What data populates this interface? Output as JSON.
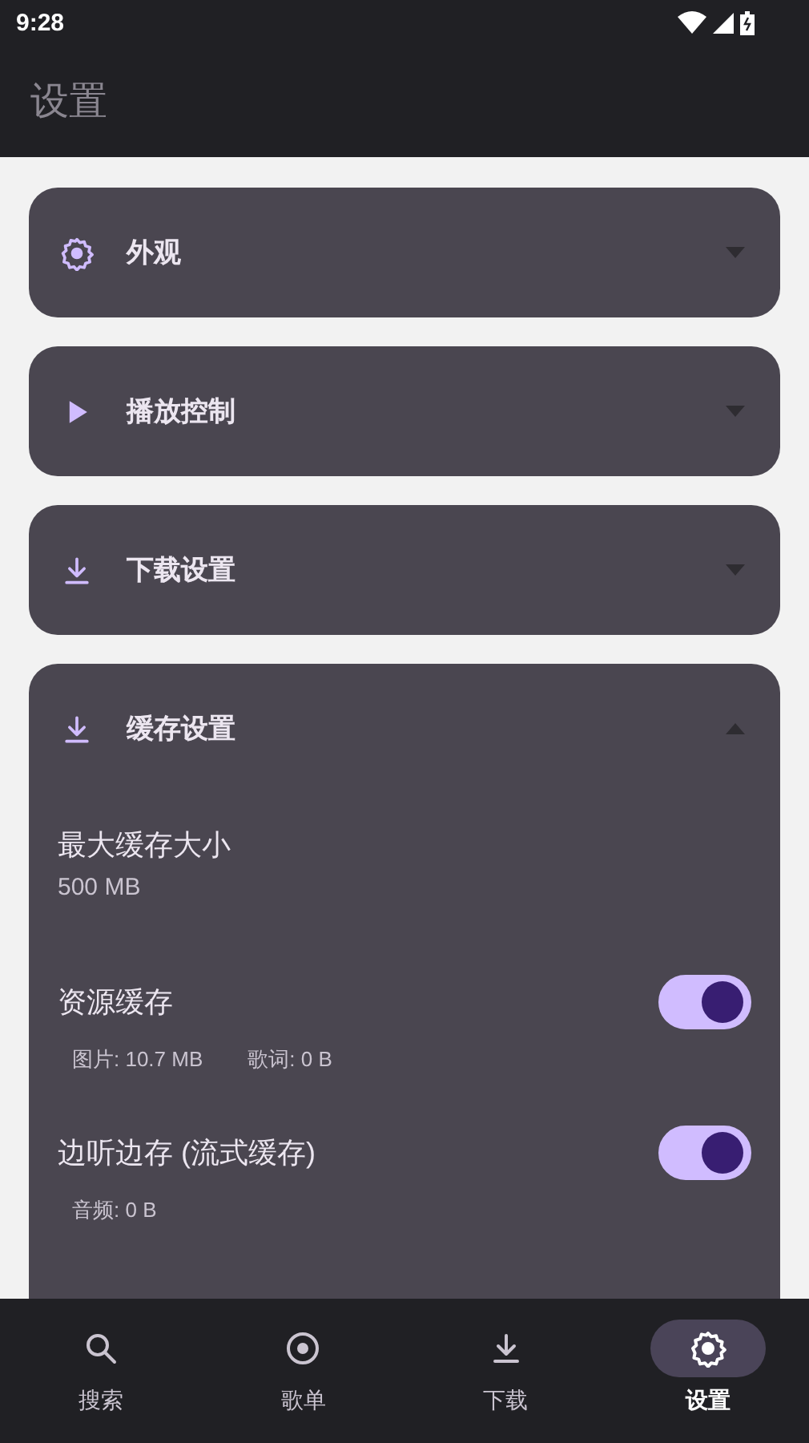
{
  "status_bar": {
    "time": "9:28"
  },
  "app_bar": {
    "title": "设置"
  },
  "sections": [
    {
      "kind": "gear",
      "title": "外观",
      "expanded": false
    },
    {
      "kind": "play",
      "title": "播放控制",
      "expanded": false
    },
    {
      "kind": "download",
      "title": "下载设置",
      "expanded": false
    },
    {
      "kind": "download",
      "title": "缓存设置",
      "expanded": true,
      "items": [
        {
          "kind": "value",
          "title": "最大缓存大小",
          "value": "500 MB"
        },
        {
          "kind": "toggle",
          "title": "资源缓存",
          "on": true,
          "stats": [
            "图片: 10.7 MB",
            "歌词: 0 B"
          ]
        },
        {
          "kind": "toggle",
          "title": "边听边存 (流式缓存)",
          "on": true,
          "stats": [
            "音频: 0 B"
          ]
        }
      ]
    }
  ],
  "nav": [
    {
      "kind": "search",
      "label": "搜索",
      "selected": false
    },
    {
      "kind": "disc",
      "label": "歌单",
      "selected": false
    },
    {
      "kind": "download",
      "label": "下载",
      "selected": false
    },
    {
      "kind": "gear",
      "label": "设置",
      "selected": true
    }
  ]
}
